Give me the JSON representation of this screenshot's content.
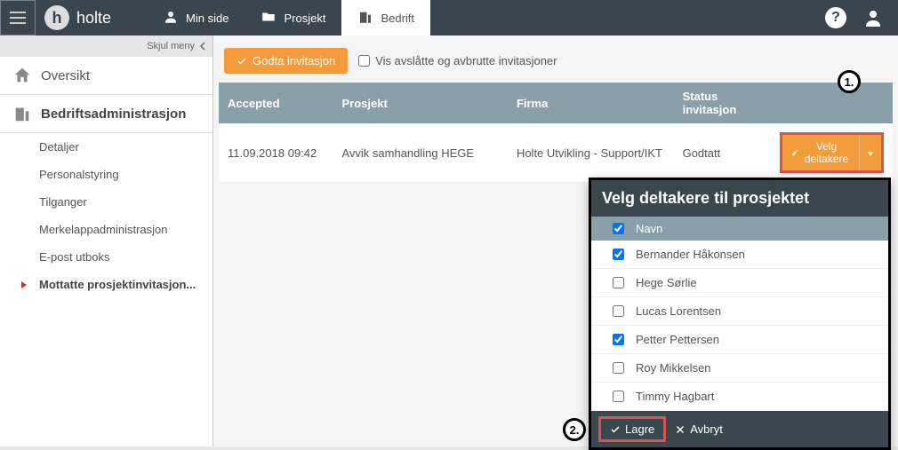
{
  "header": {
    "logo_text": "holte",
    "nav": {
      "min_side": "Min side",
      "prosjekt": "Prosjekt",
      "bedrift": "Bedrift"
    }
  },
  "sidebar": {
    "skjul": "Skjul meny",
    "oversikt": "Oversikt",
    "bedrift_admin": "Bedriftsadministrasjon",
    "items": {
      "detaljer": "Detaljer",
      "personalstyring": "Personalstyring",
      "tilganger": "Tilganger",
      "merkelapp": "Merkelappadministrasjon",
      "epost": "E-post utboks",
      "mottatte": "Mottatte prosjektinvitasjon..."
    }
  },
  "toolbar": {
    "godta": "Godta invitasjon",
    "vis_avslatte": "Vis avslåtte og avbrutte invitasjoner"
  },
  "grid": {
    "headers": {
      "accepted": "Accepted",
      "prosjekt": "Prosjekt",
      "firma": "Firma",
      "status": "Status invitasjon"
    },
    "row": {
      "accepted": "11.09.2018 09:42",
      "prosjekt": "Avvik samhandling HEGE",
      "firma": "Holte Utvikling - Support/IKT",
      "status": "Godtatt",
      "velg_btn": "Velg deltakere"
    }
  },
  "popup": {
    "title": "Velg deltakere til prosjektet",
    "col_navn": "Navn",
    "rows": [
      {
        "name": "Bernander Håkonsen",
        "checked": true
      },
      {
        "name": "Hege Sørlie",
        "checked": false
      },
      {
        "name": "Lucas Lorentsen",
        "checked": false
      },
      {
        "name": "Petter Pettersen",
        "checked": true
      },
      {
        "name": "Roy Mikkelsen",
        "checked": false
      },
      {
        "name": "Timmy Hagbart",
        "checked": false
      }
    ],
    "lagre": "Lagre",
    "avbryt": "Avbryt"
  },
  "badges": {
    "one": "1.",
    "two": "2."
  }
}
